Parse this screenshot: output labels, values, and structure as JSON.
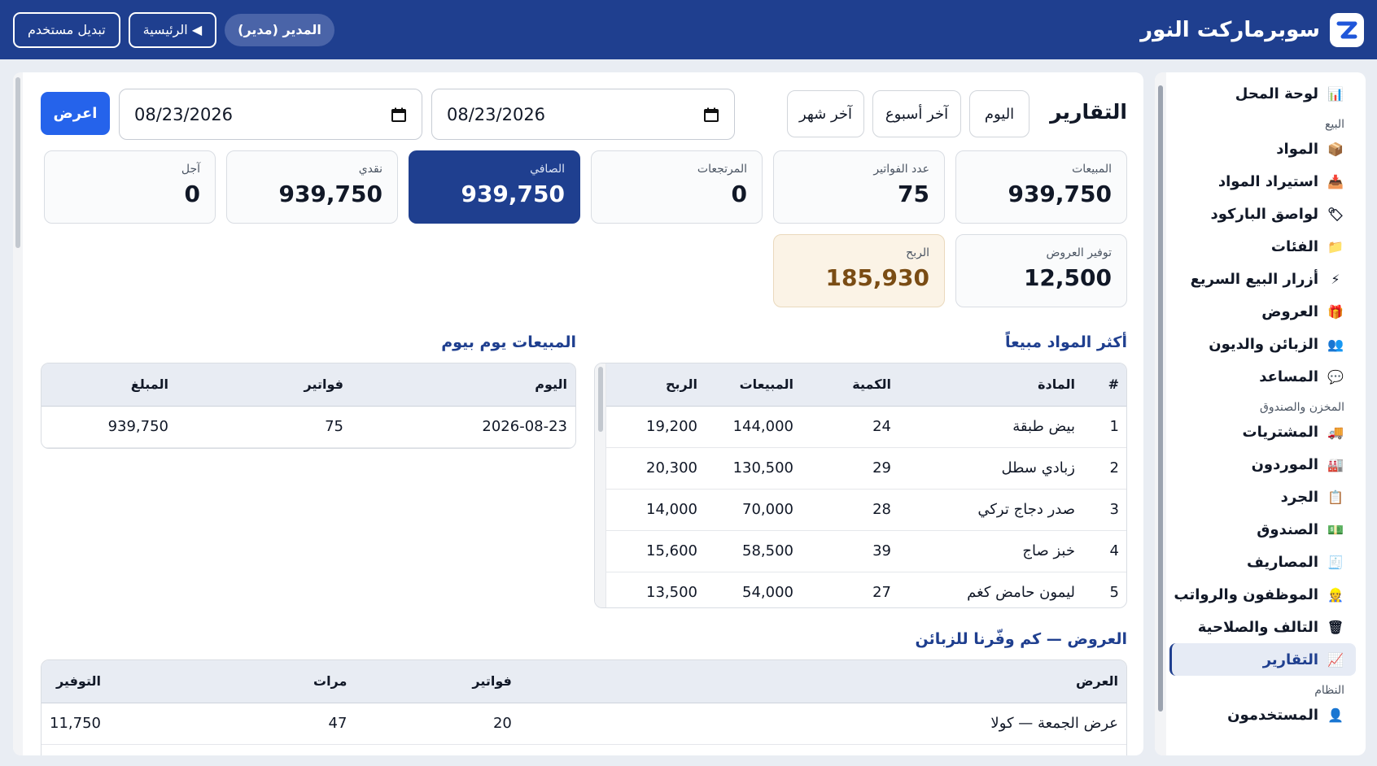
{
  "app": {
    "title": "سوبرماركت النور",
    "logo_letter": "Z"
  },
  "header": {
    "user_pill": "المدير (مدير)",
    "home_button": "◀ الرئيسية",
    "switch_user_button": "تبديل مستخدم"
  },
  "sidebar": {
    "dashboard": "لوحة المحل",
    "sections": {
      "sales": "البيع",
      "store": "المخزن والصندوق",
      "system": "النظام"
    },
    "sales_items": [
      {
        "label": "المواد",
        "icon": "box-icon"
      },
      {
        "label": "استيراد المواد",
        "icon": "import-icon"
      },
      {
        "label": "لواصق الباركود",
        "icon": "tag-icon"
      },
      {
        "label": "الفئات",
        "icon": "folder-icon"
      },
      {
        "label": "أزرار البيع السريع",
        "icon": "lightning-icon"
      },
      {
        "label": "العروض",
        "icon": "gift-icon"
      },
      {
        "label": "الزبائن والديون",
        "icon": "users-icon"
      },
      {
        "label": "المساعد",
        "icon": "chat-icon"
      }
    ],
    "store_items": [
      {
        "label": "المشتريات",
        "icon": "truck-icon"
      },
      {
        "label": "الموردون",
        "icon": "factory-icon"
      },
      {
        "label": "الجرد",
        "icon": "clipboard-icon"
      },
      {
        "label": "الصندوق",
        "icon": "cash-icon"
      },
      {
        "label": "المصاريف",
        "icon": "receipt-icon"
      },
      {
        "label": "الموظفون والرواتب",
        "icon": "worker-icon"
      },
      {
        "label": "التالف والصلاحية",
        "icon": "trash-icon"
      },
      {
        "label": "التقارير",
        "icon": "chart-icon"
      }
    ],
    "system_items": [
      {
        "label": "المستخدمون",
        "icon": "user-icon"
      }
    ]
  },
  "reports": {
    "title": "التقارير",
    "ranges": {
      "today": "اليوم",
      "last_week": "آخر أسبوع",
      "last_month": "آخر شهر"
    },
    "date_from": "08/23/2026",
    "date_to": "08/23/2026",
    "show_button": "اعرض",
    "cards": {
      "sales": {
        "label": "المبيعات",
        "value": "939,750"
      },
      "invoices": {
        "label": "عدد الفواتير",
        "value": "75"
      },
      "returns": {
        "label": "المرتجعات",
        "value": "0"
      },
      "net": {
        "label": "الصافي",
        "value": "939,750"
      },
      "cash": {
        "label": "نقدي",
        "value": "939,750"
      },
      "credit": {
        "label": "آجل",
        "value": "0"
      },
      "offers_saving": {
        "label": "توفير العروض",
        "value": "12,500"
      },
      "profit": {
        "label": "الربح",
        "value": "185,930"
      }
    },
    "top_items": {
      "title": "أكثر المواد مبيعاً",
      "headers": [
        "#",
        "المادة",
        "الكمية",
        "المبيعات",
        "الربح"
      ],
      "rows": [
        [
          "1",
          "بيض طبقة",
          "24",
          "144,000",
          "19,200"
        ],
        [
          "2",
          "زبادي سطل",
          "29",
          "130,500",
          "20,300"
        ],
        [
          "3",
          "صدر دجاج تركي",
          "28",
          "70,000",
          "14,000"
        ],
        [
          "4",
          "خبز صاج",
          "39",
          "58,500",
          "15,600"
        ],
        [
          "5",
          "ليمون حامض كغم",
          "27",
          "54,000",
          "13,500"
        ]
      ]
    },
    "daily_sales": {
      "title": "المبيعات يوم بيوم",
      "headers": [
        "اليوم",
        "فواتير",
        "المبلغ"
      ],
      "rows": [
        [
          "2026-08-23",
          "75",
          "939,750"
        ]
      ]
    },
    "offers": {
      "title": "العروض — كم وفّرنا للزبائن",
      "headers": [
        "العرض",
        "فواتير",
        "مرات",
        "التوفير"
      ],
      "rows": [
        [
          "عرض الجمعة — كولا",
          "20",
          "47",
          "11,750"
        ]
      ]
    }
  }
}
